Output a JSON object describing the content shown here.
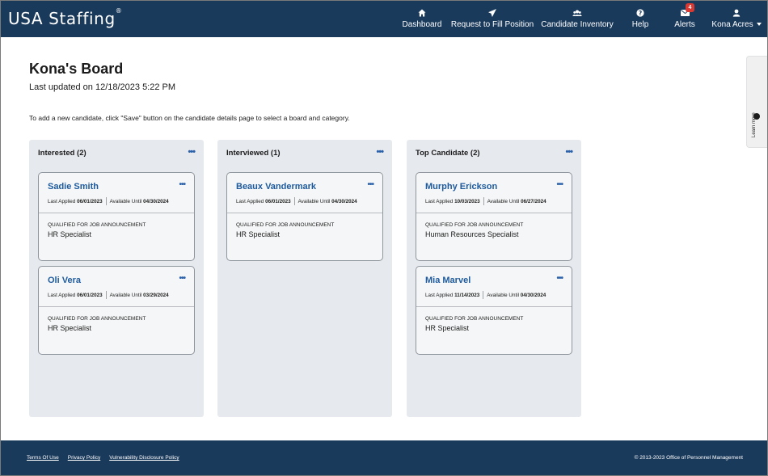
{
  "header": {
    "logo_text": "USA Staffing",
    "logo_mark": "®",
    "nav": [
      {
        "label": "Dashboard",
        "icon": "home-icon"
      },
      {
        "label": "Request to Fill Position",
        "icon": "paper-plane-icon"
      },
      {
        "label": "Candidate Inventory",
        "icon": "users-icon"
      },
      {
        "label": "Help",
        "icon": "question-circle-icon"
      },
      {
        "label": "Alerts",
        "icon": "envelope-icon",
        "badge": "4"
      },
      {
        "label": "Kona Acres",
        "icon": "user-icon"
      }
    ]
  },
  "page": {
    "title": "Kona's Board",
    "last_updated": "Last updated on 12/18/2023 5:22 PM",
    "instructions": "To add a new candidate, click \"Save\" button on the candidate details page to select a board and category."
  },
  "learn_more": {
    "label": "Learn more"
  },
  "more_glyph": "•••",
  "columns": [
    {
      "title": "Interested (2)",
      "cards": [
        {
          "name": "Sadie Smith",
          "last_applied_label": "Last Applied",
          "last_applied": "06/01/2023",
          "available_label": "Available Until",
          "available": "04/30/2024",
          "qual_label": "QUALIFIED FOR JOB ANNOUNCEMENT",
          "qual_value": "HR Specialist"
        },
        {
          "name": "Oli Vera",
          "last_applied_label": "Last Applied",
          "last_applied": "06/01/2023",
          "available_label": "Available Until",
          "available": "03/29/2024",
          "qual_label": "QUALIFIED FOR JOB ANNOUNCEMENT",
          "qual_value": "HR Specialist"
        }
      ]
    },
    {
      "title": "Interviewed (1)",
      "cards": [
        {
          "name": "Beaux Vandermark",
          "last_applied_label": "Last Applied",
          "last_applied": "06/01/2023",
          "available_label": "Available Until",
          "available": "04/30/2024",
          "qual_label": "QUALIFIED FOR JOB ANNOUNCEMENT",
          "qual_value": "HR Specialist"
        }
      ]
    },
    {
      "title": "Top Candidate (2)",
      "cards": [
        {
          "name": "Murphy Erickson",
          "last_applied_label": "Last Applied",
          "last_applied": "10/03/2023",
          "available_label": "Available Until",
          "available": "06/27/2024",
          "qual_label": "QUALIFIED FOR JOB ANNOUNCEMENT",
          "qual_value": "Human Resources Specialist"
        },
        {
          "name": "Mia Marvel",
          "last_applied_label": "Last Applied",
          "last_applied": "11/14/2023",
          "available_label": "Available Until",
          "available": "04/30/2024",
          "qual_label": "QUALIFIED FOR JOB ANNOUNCEMENT",
          "qual_value": "HR Specialist"
        }
      ]
    }
  ],
  "footer": {
    "links": [
      "Terms Of Use",
      "Privacy Policy",
      "Vulnerability Disclosure Policy"
    ],
    "copyright": "© 2013-2023 Office of Personnel Management"
  },
  "colors": {
    "header_bg": "#1a3a5c",
    "link": "#1d5a9e",
    "column_bg": "#e6e9ee",
    "badge": "#d83933"
  }
}
